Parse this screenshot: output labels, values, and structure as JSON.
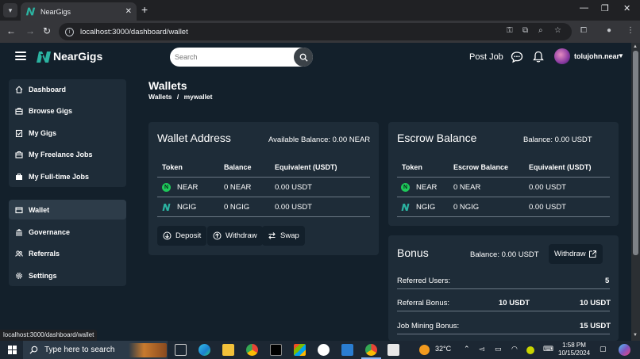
{
  "browser": {
    "tab_title": "NearGigs",
    "url": "localhost:3000/dashboard/wallet",
    "status_url": "localhost:3000/dashboard/wallet"
  },
  "header": {
    "brand": "NearGigs",
    "search_placeholder": "Search",
    "post_job": "Post Job",
    "username": "tolujohn.near"
  },
  "sidebar": {
    "items": [
      {
        "label": "Dashboard",
        "icon": "home-icon"
      },
      {
        "label": "Browse Gigs",
        "icon": "briefcase-icon"
      },
      {
        "label": "My Gigs",
        "icon": "clipboard-icon"
      },
      {
        "label": "My Freelance Jobs",
        "icon": "briefcase-icon"
      },
      {
        "label": "My Full-time Jobs",
        "icon": "briefcase-filled-icon"
      },
      {
        "label": "Wallet",
        "icon": "wallet-icon"
      },
      {
        "label": "Governance",
        "icon": "bank-icon"
      },
      {
        "label": "Referrals",
        "icon": "users-icon"
      },
      {
        "label": "Settings",
        "icon": "gear-icon"
      }
    ],
    "active": "Wallet"
  },
  "page": {
    "title": "Wallets",
    "breadcrumb": [
      "Wallets",
      "/",
      "mywallet"
    ]
  },
  "wallet": {
    "title": "Wallet Address",
    "available_balance": "Available Balance: 0.00 NEAR",
    "headers": [
      "Token",
      "Balance",
      "Equivalent (USDT)"
    ],
    "rows": [
      {
        "token": "NEAR",
        "balance": "0 NEAR",
        "equivalent": "0.00 USDT"
      },
      {
        "token": "NGIG",
        "balance": "0 NGIG",
        "equivalent": "0.00 USDT"
      }
    ],
    "buttons": {
      "deposit": "Deposit",
      "withdraw": "Withdraw",
      "swap": "Swap"
    }
  },
  "escrow": {
    "title": "Escrow Balance",
    "balance": "Balance: 0.00 USDT",
    "headers": [
      "Token",
      "Escrow Balance",
      "Equivalent (USDT)"
    ],
    "rows": [
      {
        "token": "NEAR",
        "balance": "0 NEAR",
        "equivalent": "0.00 USDT"
      },
      {
        "token": "NGIG",
        "balance": "0 NGIG",
        "equivalent": "0.00 USDT"
      }
    ]
  },
  "bonus": {
    "title": "Bonus",
    "balance": "Balance: 0.00 USDT",
    "withdraw": "Withdraw",
    "rows": [
      {
        "label": "Referred Users:",
        "mid": "",
        "value": "5"
      },
      {
        "label": "Referral Bonus:",
        "mid": "10 USDT",
        "value": "10 USDT"
      },
      {
        "label": "Job Mining Bonus:",
        "mid": "",
        "value": "15 USDT"
      }
    ]
  },
  "taskbar": {
    "search_text": "Type here to search",
    "temperature": "32°C",
    "time": "1:58 PM",
    "date": "10/15/2024"
  },
  "colors": {
    "background": "#13202b",
    "card": "#1e2c38",
    "near_green": "#1ec85a",
    "ngig_teal": "#2bb3a1"
  }
}
